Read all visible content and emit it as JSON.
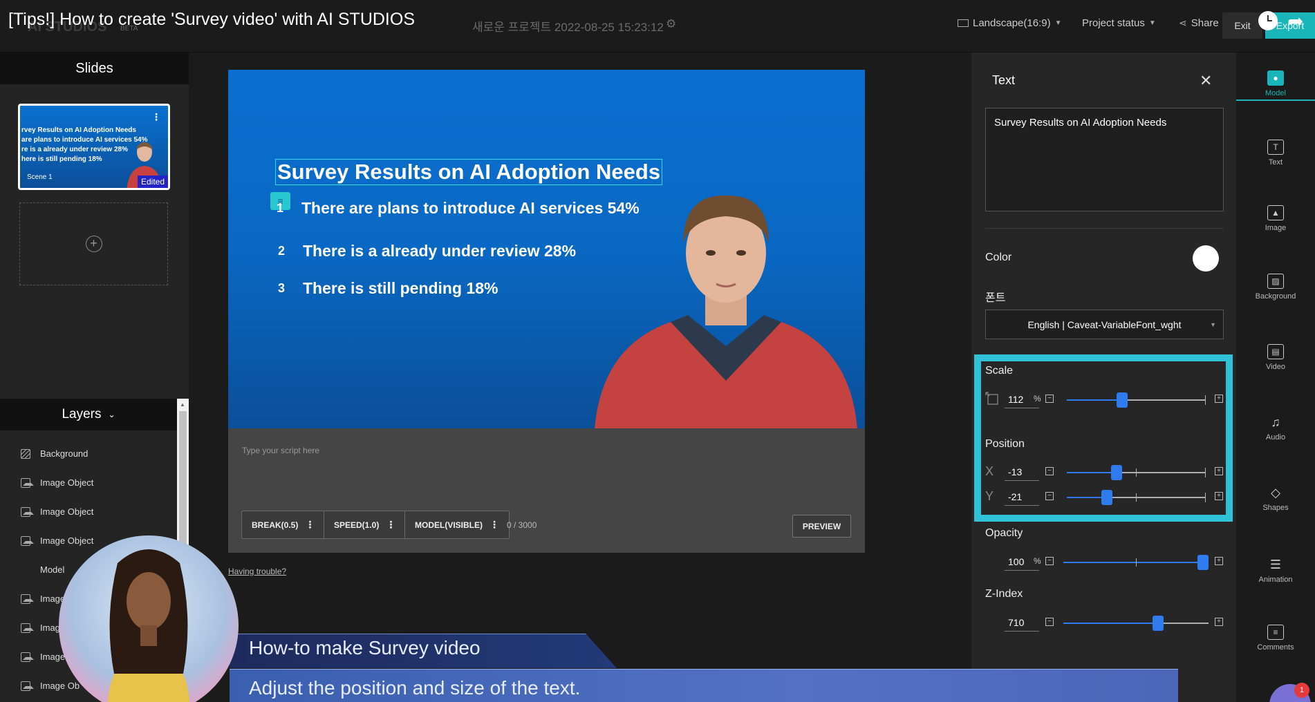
{
  "video_title": "[Tips!] How to create 'Survey video' with AI STUDIOS",
  "logo": {
    "name": "AI STUDIOS",
    "beta": "BETA"
  },
  "project": {
    "name": "새로운 프로젝트 2022-08-25 15:23:12"
  },
  "toolbar": {
    "aspect": "Landscape(16:9)",
    "project_status": "Project status",
    "share": "Share",
    "exit": "Exit",
    "export": "Export"
  },
  "slides": {
    "header": "Slides",
    "thumb_lines": [
      "rvey Results on AI Adoption Needs",
      "are plans to introduce AI services 54%",
      "re is a already under review 28%",
      "here is still pending 18%"
    ],
    "scene_label": "Scene 1",
    "edited_badge": "Edited"
  },
  "layers": {
    "header": "Layers",
    "items": [
      {
        "label": "Background",
        "icon": "background-icon"
      },
      {
        "label": "Image Object",
        "icon": "image-icon"
      },
      {
        "label": "Image Object",
        "icon": "image-icon"
      },
      {
        "label": "Image Object",
        "icon": "image-icon"
      },
      {
        "label": "Model",
        "icon": "person-icon"
      },
      {
        "label": "Image",
        "icon": "image-icon"
      },
      {
        "label": "Image",
        "icon": "image-icon"
      },
      {
        "label": "Image",
        "icon": "image-icon"
      },
      {
        "label": "Image Ob",
        "icon": "image-icon"
      }
    ]
  },
  "canvas": {
    "title": "Survey Results on AI Adoption Needs",
    "bullets": [
      {
        "num": "1",
        "text": "There are plans to introduce AI services 54%"
      },
      {
        "num": "2",
        "text": "There is a already under review 28%"
      },
      {
        "num": "3",
        "text": "There is still pending 18%"
      }
    ]
  },
  "script": {
    "placeholder": "Type your script here",
    "break_btn": "BREAK(0.5)",
    "speed_btn": "SPEED(1.0)",
    "model_btn": "MODEL(VISIBLE)",
    "char_count": "0 / 3000",
    "preview_btn": "PREVIEW",
    "trouble_link": "Having trouble?"
  },
  "caption": {
    "top": "How-to make Survey video",
    "bottom": "Adjust the position and size of the text."
  },
  "props": {
    "title": "Text",
    "text_value": "Survey Results on AI Adoption Needs",
    "color_label": "Color",
    "color_value": "#ffffff",
    "font_label": "폰트",
    "font_value": "English | Caveat-VariableFont_wght",
    "scale_label": "Scale",
    "scale_value": "112",
    "scale_level": 0.4,
    "pct": "%",
    "position_label": "Position",
    "x_label": "X",
    "x_value": "-13",
    "x_level": 0.36,
    "y_label": "Y",
    "y_value": "-21",
    "y_level": 0.29,
    "opacity_label": "Opacity",
    "opacity_value": "100",
    "opacity_level": 1.0,
    "zindex_label": "Z-Index",
    "zindex_value": "710",
    "zindex_level": 0.65
  },
  "right_tools": [
    {
      "label": "Model",
      "icon": "model-icon",
      "active": true
    },
    {
      "label": "Text",
      "icon": "text-icon"
    },
    {
      "label": "Image",
      "icon": "image-icon"
    },
    {
      "label": "Background",
      "icon": "background-icon"
    },
    {
      "label": "Video",
      "icon": "video-icon"
    },
    {
      "label": "Audio",
      "icon": "audio-icon"
    },
    {
      "label": "Shapes",
      "icon": "shapes-icon"
    },
    {
      "label": "Animation",
      "icon": "animation-icon"
    },
    {
      "label": "Comments",
      "icon": "comments-icon"
    }
  ],
  "chat": {
    "badge_count": "1"
  },
  "colors": {
    "accent": "#1ab5b8",
    "highlight": "#2ec1d8",
    "slider": "#2f7cf0",
    "canvas_top": "#0a6fd0",
    "canvas_bottom": "#0b4f99"
  }
}
